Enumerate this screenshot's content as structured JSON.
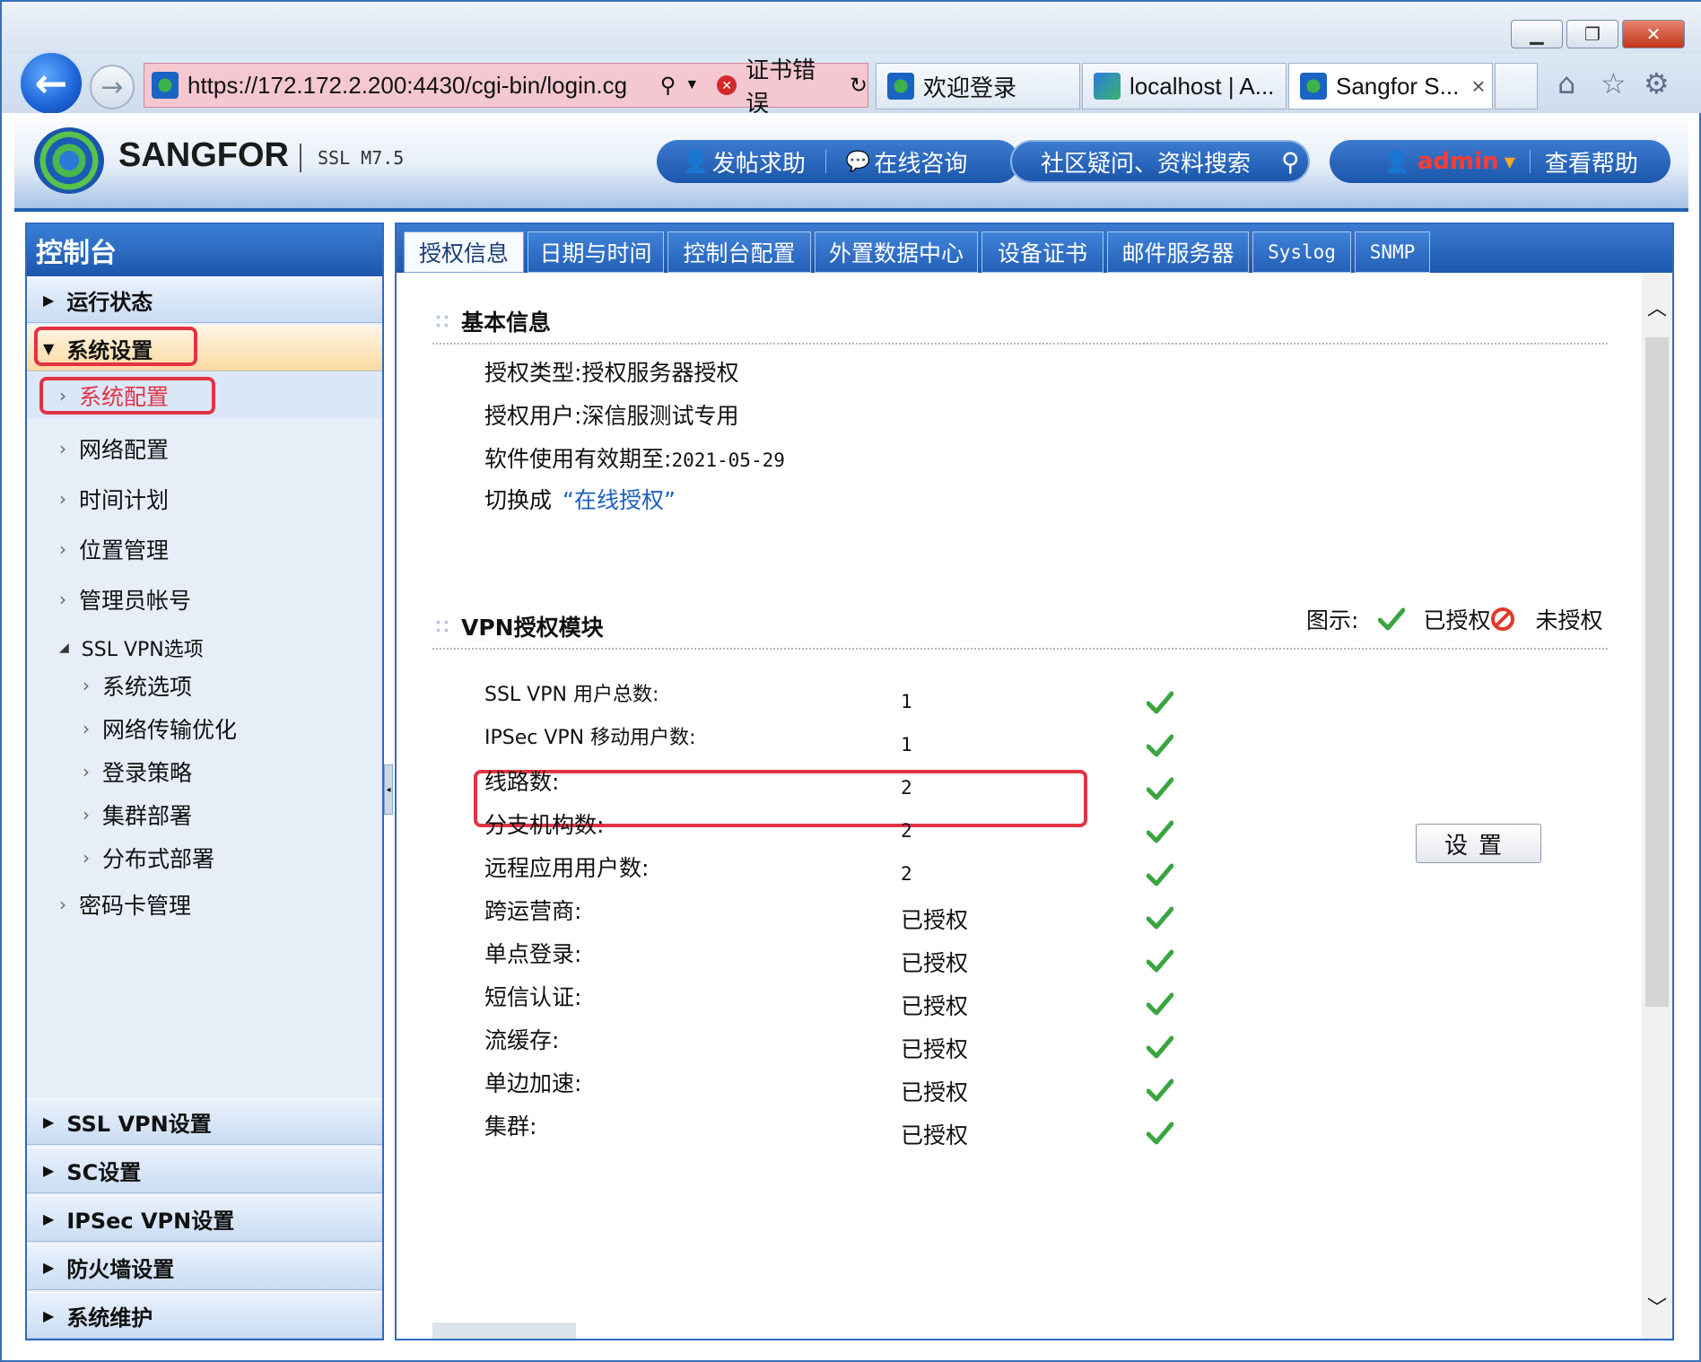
{
  "browser": {
    "address": "https://172.172.2.200:4430/cgi-bin/login.cg",
    "cert_error": "证书错误",
    "tabs": [
      {
        "label": "欢迎登录"
      },
      {
        "label": "localhost | A..."
      },
      {
        "label": "Sangfor S...",
        "close": "×"
      }
    ]
  },
  "header": {
    "brand": "SANGFOR",
    "version": "SSL M7.5",
    "post_help": "发帖求助",
    "online_consult": "在线咨询",
    "search_placeholder": "社区疑问、资料搜索",
    "user": "admin",
    "view_help": "查看帮助"
  },
  "sidebar": {
    "title": "控制台",
    "sections_top": [
      {
        "label": "运行状态"
      },
      {
        "label": "系统设置"
      }
    ],
    "items": [
      {
        "label": "系统配置"
      },
      {
        "label": "网络配置"
      },
      {
        "label": "时间计划"
      },
      {
        "label": "位置管理"
      },
      {
        "label": "管理员帐号"
      },
      {
        "label": "SSL VPN选项"
      },
      {
        "label": "系统选项"
      },
      {
        "label": "网络传输优化"
      },
      {
        "label": "登录策略"
      },
      {
        "label": "集群部署"
      },
      {
        "label": "分布式部署"
      },
      {
        "label": "密码卡管理"
      }
    ],
    "sections_bottom": [
      {
        "label": "SSL VPN设置"
      },
      {
        "label": "SC设置"
      },
      {
        "label": "IPSec VPN设置"
      },
      {
        "label": "防火墙设置"
      },
      {
        "label": "系统维护"
      }
    ]
  },
  "page_tabs": [
    "授权信息",
    "日期与时间",
    "控制台配置",
    "外置数据中心",
    "设备证书",
    "邮件服务器",
    "Syslog",
    "SNMP"
  ],
  "basic": {
    "heading": "基本信息",
    "license_type_label": "授权类型:",
    "license_type": "授权服务器授权",
    "license_user_label": "授权用户:",
    "license_user": "深信服测试专用",
    "expiry_label": "软件使用有效期至:",
    "expiry": "2021-05-29",
    "switch_label": "切换成",
    "switch_link": "“在线授权”"
  },
  "vpn": {
    "heading": "VPN授权模块",
    "legend_label": "图示:",
    "legend_authorized": "已授权",
    "legend_unauthorized": "未授权",
    "set_button": "设置",
    "rows": [
      {
        "label": "SSL VPN 用户总数:",
        "value": "1"
      },
      {
        "label": "IPSec VPN 移动用户数:",
        "value": "1"
      },
      {
        "label": "线路数:",
        "value": "2"
      },
      {
        "label": "分支机构数:",
        "value": "2"
      },
      {
        "label": "远程应用用户数:",
        "value": "2"
      },
      {
        "label": "跨运营商:",
        "value": "已授权"
      },
      {
        "label": "单点登录:",
        "value": "已授权"
      },
      {
        "label": "短信认证:",
        "value": "已授权"
      },
      {
        "label": "流缓存:",
        "value": "已授权"
      },
      {
        "label": "单边加速:",
        "value": "已授权"
      },
      {
        "label": "集群:",
        "value": "已授权"
      }
    ]
  },
  "colors": {
    "accent": "#1f5fb4",
    "highlight": "#e23345",
    "check": "#3aa540",
    "link": "#1b5fc1"
  }
}
